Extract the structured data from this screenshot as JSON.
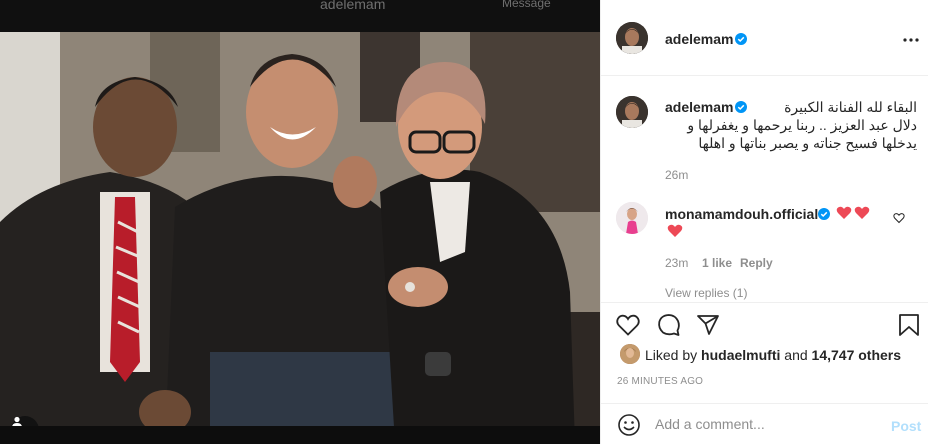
{
  "backdrop": {
    "ghost_username": "adelemam",
    "ghost_message": "Message"
  },
  "post": {
    "author": {
      "username": "adelemam",
      "verified": true,
      "avatar_icon": "profile-avatar"
    },
    "caption": {
      "username": "adelemam",
      "lines": [
        "البقاء لله الفنانة الكبيرة",
        "دلال عبد العزيز .. ربنا يرحمها و يغفرلها و",
        "يدخلها فسيح جناته و يصبر بناتها و اهلها"
      ],
      "time_ago": "26m"
    },
    "comments": [
      {
        "username": "monamamdouh.official",
        "verified": true,
        "text_icons": [
          "red-heart",
          "red-heart",
          "red-heart"
        ],
        "time_ago": "23m",
        "likes_label": "1 like",
        "reply_label": "Reply"
      }
    ],
    "view_replies_label": "View replies (1)",
    "likes": {
      "prefix": "Liked by",
      "first_liker": "hudaelmufti",
      "joiner": "and",
      "others": "14,747 others"
    },
    "posted_time": "26 MINUTES AGO",
    "comment_box": {
      "placeholder": "Add a comment...",
      "post_label": "Post"
    },
    "colors": {
      "verified_blue": "#0095f6",
      "heart_red": "#ed4956",
      "post_disabled": "#b2dffc",
      "muted": "#8e8e8e"
    }
  }
}
